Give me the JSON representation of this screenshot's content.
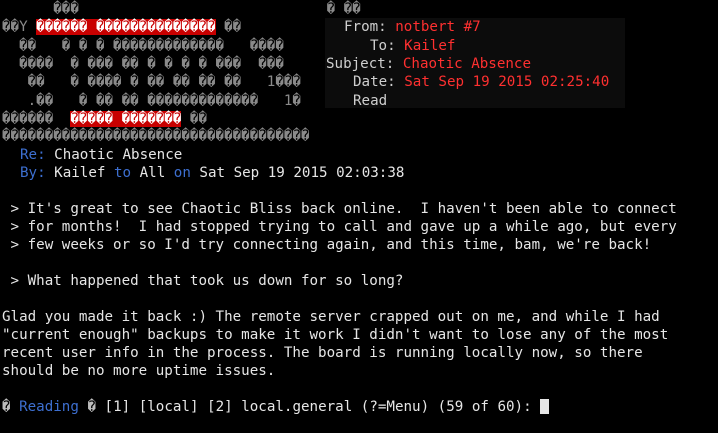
{
  "art": {
    "r0": "      ���                             � ��",
    "r1a": "��Y ",
    "r1b": "������ ��������������",
    "r1c": " ��",
    "r2": "  ��   � � � �������������   ����",
    "r3": "  ����  � ��� �� � � � � ���  ���",
    "r4": "   ��   � ���� � �� �� �� ��   1���",
    "r5": "   .��   � �� �� �������������   1�",
    "r6a": "������  ",
    "r6b": "����� �������",
    "r6c": " ��",
    "r7": "������������������������������������"
  },
  "header": {
    "from_label": "From:",
    "from_value": "notbert #7",
    "to_label": "To:",
    "to_value": "Kailef",
    "subject_label": "Subject:",
    "subject_value": "Chaotic Absence",
    "date_label": "Date:",
    "date_value": "Sat Sep 19 2015 02:25:40",
    "read_label": "Read"
  },
  "quote_header": {
    "re_label": "Re:",
    "re_value": "Chaotic Absence",
    "by_label": "By:",
    "by_name": "Kailef",
    "to_word": "to",
    "to_name": "All",
    "on_word": "on",
    "date": "Sat Sep 19 2015 02:03:38"
  },
  "body_lines": [
    " > It's great to see Chaotic Bliss back online.  I haven't been able to connect",
    " > for months!  I had stopped trying to call and gave up a while ago, but every",
    " > few weeks or so I'd try connecting again, and this time, bam, we're back!",
    "",
    " > What happened that took us down for so long?",
    "",
    "Glad you made it back :) The remote server crapped out on me, and while I had",
    "\"current enough\" backups to make it work I didn't want to lose any of the most",
    "recent user info in the process. The board is running locally now, so there",
    "should be no more uptime issues."
  ],
  "prompt": {
    "lead": "�",
    "reading": "Reading",
    "sep": "�",
    "rest": "[1] [local] [2] local.general (?=Menu) (59 of 60):"
  }
}
